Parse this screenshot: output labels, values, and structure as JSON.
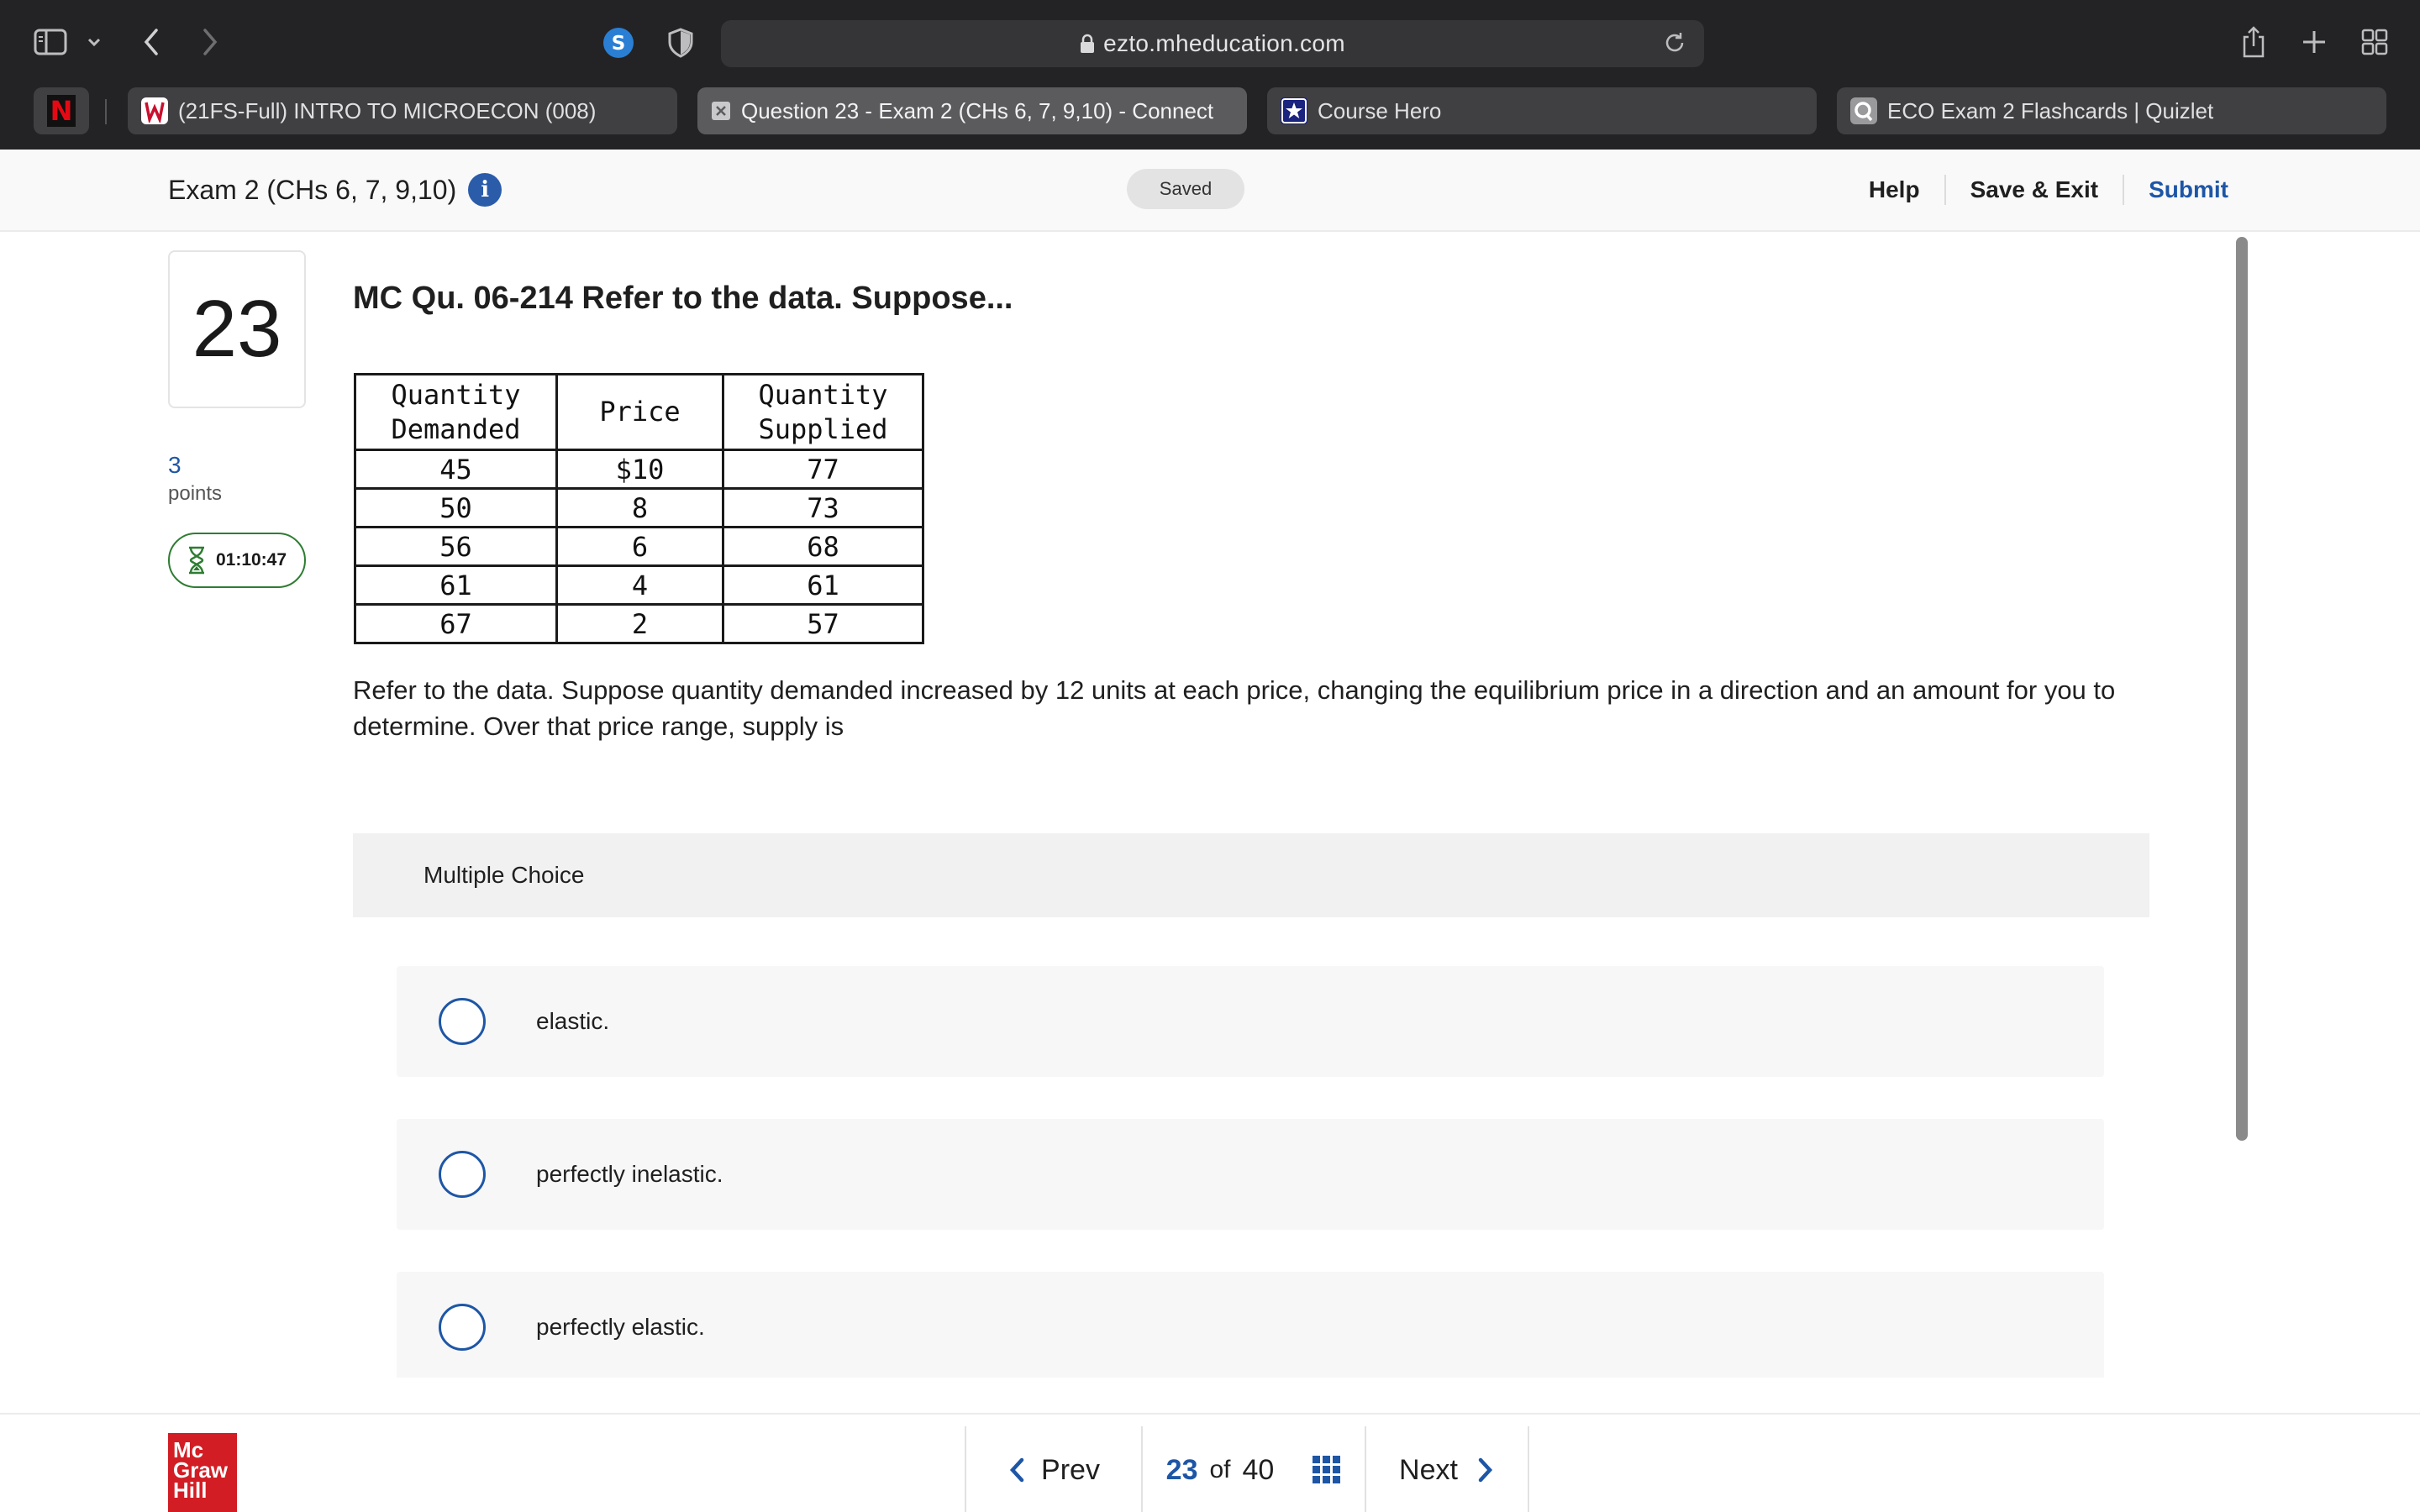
{
  "browser": {
    "url": "ezto.mheducation.com",
    "pinned_tab_label": "N",
    "tabs": [
      {
        "label": "(21FS-Full) INTRO TO MICROECON (008)",
        "active": false
      },
      {
        "label": "Question 23 - Exam 2 (CHs 6, 7, 9,10) - Connect",
        "active": true
      },
      {
        "label": "Course Hero",
        "active": false
      },
      {
        "label": "ECO Exam 2 Flashcards | Quizlet",
        "active": false
      }
    ],
    "colors": {
      "chrome_bg": "#232325",
      "urlbar_bg": "#353537",
      "tab_bg": "#404042",
      "tab_active_bg": "#5b5b5e"
    }
  },
  "header": {
    "exam_title": "Exam 2 (CHs 6, 7, 9,10)",
    "info_icon_glyph": "i",
    "saved_status": "Saved",
    "help_label": "Help",
    "save_exit_label": "Save & Exit",
    "submit_label": "Submit"
  },
  "question": {
    "number": "23",
    "points_value": "3",
    "points_label": "points",
    "timer": "01:10:47",
    "heading": "MC Qu. 06-214 Refer to the data. Suppose...",
    "table": {
      "headers": [
        [
          "Quantity",
          "Demanded"
        ],
        [
          "Price"
        ],
        [
          "Quantity",
          "Supplied"
        ]
      ],
      "rows": [
        [
          "45",
          "$10",
          "77"
        ],
        [
          "50",
          "8",
          "73"
        ],
        [
          "56",
          "6",
          "68"
        ],
        [
          "61",
          "4",
          "61"
        ],
        [
          "67",
          "2",
          "57"
        ]
      ]
    },
    "text": "Refer to the data. Suppose quantity demanded increased by 12 units at each price, changing the equilibrium price in a direction and an amount for you to determine. Over that price range, supply is"
  },
  "multiple_choice": {
    "header": "Multiple Choice",
    "options": [
      "elastic.",
      "perfectly inelastic.",
      "perfectly elastic."
    ]
  },
  "footer": {
    "logo_lines": [
      "Mc",
      "Graw",
      "Hill"
    ],
    "prev_label": "Prev",
    "current_page": "23",
    "of_label": "of",
    "total_pages": "40",
    "next_label": "Next"
  },
  "colors": {
    "accent_blue": "#1e56a6",
    "timer_green": "#2e7d32",
    "logo_red": "#d21d24"
  }
}
